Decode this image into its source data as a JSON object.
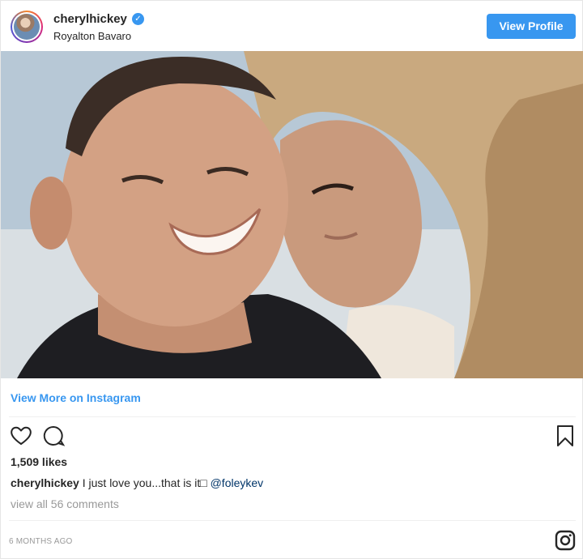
{
  "header": {
    "username": "cherylhickey",
    "verified_mark": "✓",
    "location": "Royalton Bavaro",
    "view_profile_label": "View Profile"
  },
  "post": {
    "view_more_label": "View More on Instagram",
    "likes": "1,509 likes",
    "caption_user": "cherylhickey",
    "caption_text": " I just love you...that is it□ ",
    "caption_mention": "@foleykev",
    "comments_label": "view all 56 comments",
    "timestamp": "6 MONTHS AGO"
  },
  "icons": {
    "avatar": "avatar-image",
    "verified": "verified-badge-icon",
    "like": "heart-icon",
    "comment": "comment-bubble-icon",
    "save": "bookmark-icon",
    "brand": "instagram-logo-icon"
  },
  "colors": {
    "accent": "#3897f0",
    "text": "#262626",
    "muted": "#999999",
    "mention": "#003569"
  }
}
